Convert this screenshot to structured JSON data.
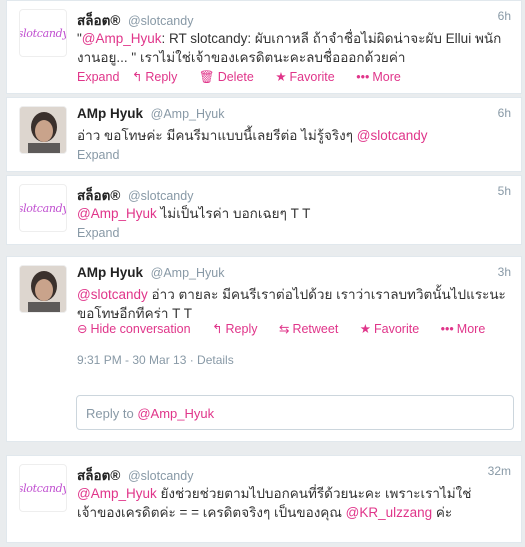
{
  "tweets": [
    {
      "name": "สล็อต®",
      "handle": "@slotcandy",
      "time": "6h",
      "avatar_text": "slotcandy",
      "text_quote_open": "\"",
      "text_mention": "@Amp_Hyuk",
      "text_rest": ": RT slotcandy: ผับเกาหลี ถ้าจำชื่อไม่ผิดน่าจะผับ Ellui พนักงานอยู... \" เราไม่ใช่เจ้าของเครดิตนะคะลบชื่อออกด้วยค่า",
      "actions": {
        "expand": "Expand",
        "reply": "Reply",
        "delete": "Delete",
        "favorite": "Favorite",
        "more": "More"
      }
    },
    {
      "name": "AMp Hyuk",
      "handle": "@Amp_Hyuk",
      "time": "6h",
      "text_main": "อ่าว ขอโทษค่ะ มีคนรีมาแบบนี้เลยรีต่อ ไม่รู้จริงๆ",
      "text_mention": "@slotcandy",
      "expand": "Expand"
    },
    {
      "name": "สล็อต®",
      "handle": "@slotcandy",
      "time": "5h",
      "avatar_text": "slotcandy",
      "text_mention": "@Amp_Hyuk",
      "text_rest": "ไม่เป็นไรค่า บอกเฉยๆ T T",
      "expand": "Expand"
    },
    {
      "name": "AMp Hyuk",
      "handle": "@Amp_Hyuk",
      "time": "3h",
      "text_mention": "@slotcandy",
      "text_rest": "อ่าว ตายละ มีคนรีเราต่อไปด้วย เราว่าเราลบทวิตนั้นไปแระนะ ขอโทษอีกทีคร่า T T",
      "actions": {
        "hide": "Hide conversation",
        "reply": "Reply",
        "retweet": "Retweet",
        "favorite": "Favorite",
        "more": "More"
      },
      "meta": "9:31 PM - 30 Mar 13 · Details"
    },
    {
      "name": "สล็อต®",
      "handle": "@slotcandy",
      "time": "32m",
      "avatar_text": "slotcandy",
      "text_mention": "@Amp_Hyuk",
      "text_rest": "ยังช่วยช่วยตามไปบอกคนที่รีด้วยนะคะ เพราะเราไม่ใช่เจ้าของเครดิตค่ะ = = เครดิตจริงๆ เป็นของคุณ",
      "text_mention2": "@KR_ulzzang",
      "text_end": "ค่ะ"
    }
  ],
  "reply_box": {
    "prefix": "Reply to",
    "mention": "@Amp_Hyuk"
  },
  "colors": {
    "accent": "#e0358a",
    "muted": "#8899a6",
    "background": "#e9ecee"
  }
}
